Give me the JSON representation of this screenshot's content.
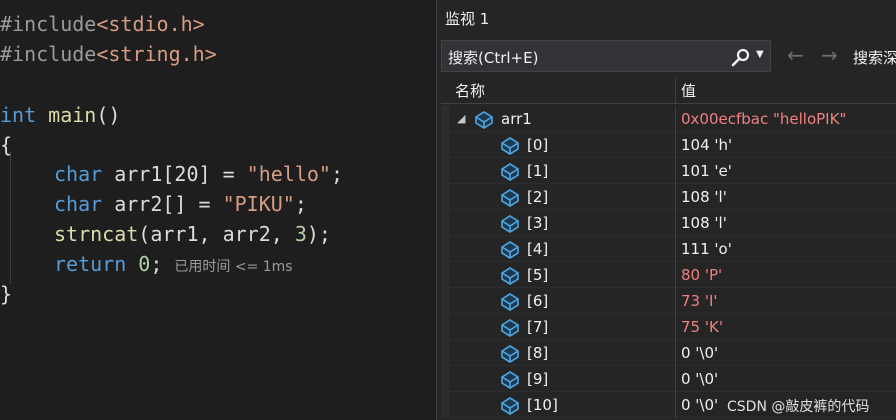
{
  "editor": {
    "line1": {
      "directive": "#include",
      "header": "<stdio.h>"
    },
    "line2": {
      "directive": "#include",
      "header": "<string.h>"
    },
    "line4": {
      "type": "int",
      "name": "main",
      "parens": "()"
    },
    "open_brace": "{",
    "line6": {
      "type": "char",
      "decl": "arr1[20] = ",
      "literal": "\"hello\"",
      "end": ";"
    },
    "line7": {
      "type": "char",
      "decl": "arr2[] = ",
      "literal": "\"PIKU\"",
      "end": ";"
    },
    "line8": {
      "fn": "strncat",
      "args_a": "(arr1, arr2, ",
      "num": "3",
      "args_b": ");"
    },
    "line9": {
      "kw": "return",
      "num": "0",
      "end": ";",
      "hint": "已用时间 <= 1ms"
    },
    "close_brace": "}"
  },
  "watch": {
    "title": "监视 1",
    "search_placeholder": "搜索(Ctrl+E)",
    "back_arrow": "←",
    "forward_arrow": "→",
    "search_depth_label": "搜索深",
    "col_name": "名称",
    "col_value": "值",
    "rows": [
      {
        "name": "arr1",
        "value": "0x00ecfbac \"helloPIK\"",
        "changed": true,
        "expanded": true
      },
      {
        "name": "[0]",
        "value": "104 'h'",
        "changed": false
      },
      {
        "name": "[1]",
        "value": "101 'e'",
        "changed": false
      },
      {
        "name": "[2]",
        "value": "108 'l'",
        "changed": false
      },
      {
        "name": "[3]",
        "value": "108 'l'",
        "changed": false
      },
      {
        "name": "[4]",
        "value": "111 'o'",
        "changed": false
      },
      {
        "name": "[5]",
        "value": "80 'P'",
        "changed": true
      },
      {
        "name": "[6]",
        "value": "73 'I'",
        "changed": true
      },
      {
        "name": "[7]",
        "value": "75 'K'",
        "changed": true
      },
      {
        "name": "[8]",
        "value": "0 '\\0'",
        "changed": false
      },
      {
        "name": "[9]",
        "value": "0 '\\0'",
        "changed": false
      },
      {
        "name": "[10]",
        "value": "0 '\\0'",
        "changed": false
      }
    ]
  },
  "watermark": "CSDN @敲皮裤的代码",
  "colors": {
    "accent_changed": "#f08080",
    "keyword": "#569cd6",
    "string": "#d69d85",
    "icon": "#4fa6e0"
  }
}
